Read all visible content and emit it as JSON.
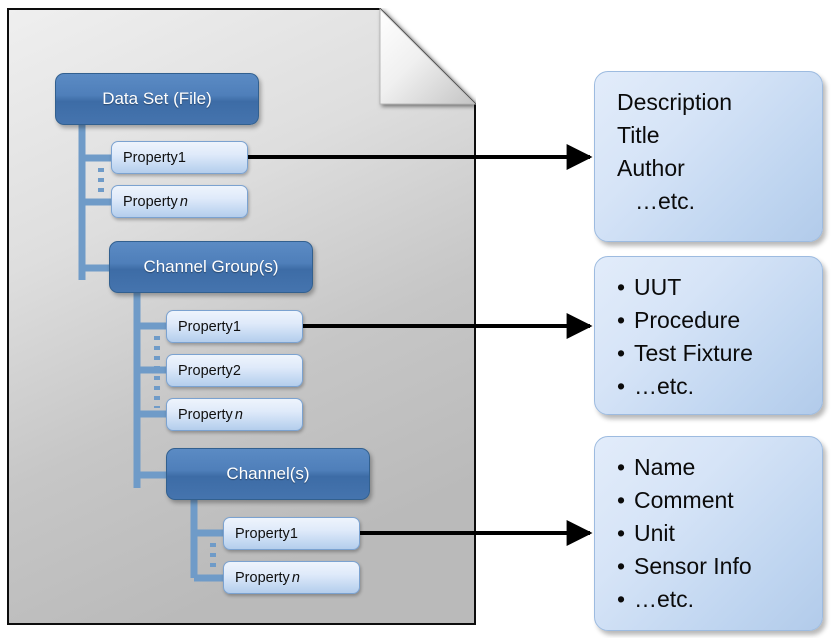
{
  "diagram": {
    "title": "Data Set file structure with property callouts",
    "colors": {
      "node_main_fill": "#4f7fba",
      "node_main_border": "#32608f",
      "node_prop_fill": "#cfe0f6",
      "node_prop_border": "#7ba2d0",
      "callout_fill": "#cddef4",
      "callout_border": "#9dbbe0",
      "connector": "#6f9bc8",
      "arrow": "#000000",
      "page_fill_top": "#ececec",
      "page_fill_bottom": "#b9b9b9",
      "page_border": "#000000"
    }
  },
  "tree": {
    "groups": [
      {
        "id": "data-set",
        "heading": "Data Set (File)",
        "properties": [
          {
            "label": "Property ",
            "suffix": "1",
            "italic_suffix": false
          },
          {
            "label": "Property ",
            "suffix": "n",
            "italic_suffix": true
          }
        ]
      },
      {
        "id": "channel-group",
        "heading": "Channel Group(s)",
        "properties": [
          {
            "label": "Property ",
            "suffix": "1",
            "italic_suffix": false
          },
          {
            "label": "Property ",
            "suffix": "2",
            "italic_suffix": false
          },
          {
            "label": "Property ",
            "suffix": "n",
            "italic_suffix": true
          }
        ]
      },
      {
        "id": "channel",
        "heading": "Channel(s)",
        "properties": [
          {
            "label": "Property ",
            "suffix": "1",
            "italic_suffix": false
          },
          {
            "label": "Property ",
            "suffix": "n",
            "italic_suffix": true
          }
        ]
      }
    ]
  },
  "callouts": [
    {
      "id": "data-set-properties",
      "bulleted": false,
      "lines": [
        "Description",
        "Title",
        "Author",
        "…etc."
      ],
      "indent_last": true
    },
    {
      "id": "channel-group-properties",
      "bulleted": true,
      "lines": [
        "UUT",
        "Procedure",
        "Test Fixture",
        "…etc."
      ],
      "bullet_glyph": "•"
    },
    {
      "id": "channel-properties",
      "bulleted": true,
      "lines": [
        "Name",
        "Comment",
        "Unit",
        "Sensor Info",
        "…etc."
      ],
      "bullet_glyph": "•"
    }
  ]
}
